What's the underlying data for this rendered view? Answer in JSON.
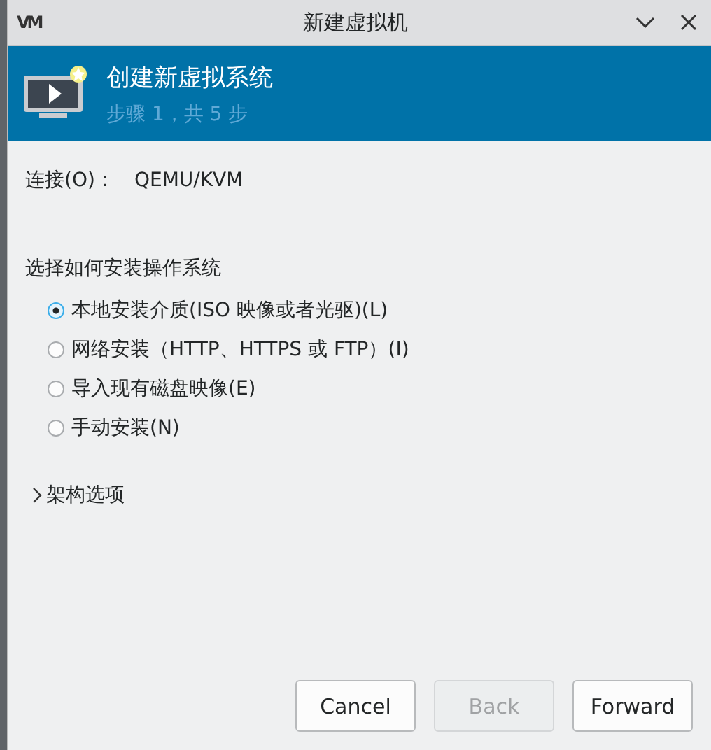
{
  "window": {
    "logo": "VM",
    "title": "新建虚拟机"
  },
  "header": {
    "title": "创建新虚拟系统",
    "step": "步骤 1，共 5 步"
  },
  "connection": {
    "label": "连接(O)：",
    "value": "QEMU/KVM"
  },
  "install": {
    "heading": "选择如何安装操作系统",
    "options": [
      {
        "label": "本地安装介质(ISO 映像或者光驱)(L)",
        "selected": true
      },
      {
        "label": "网络安装（HTTP、HTTPS 或 FTP）(I)",
        "selected": false
      },
      {
        "label": "导入现有磁盘映像(E)",
        "selected": false
      },
      {
        "label": "手动安装(N)",
        "selected": false
      }
    ]
  },
  "expander": {
    "label": "架构选项",
    "expanded": false
  },
  "buttons": [
    {
      "label": "Cancel",
      "disabled": false
    },
    {
      "label": "Back",
      "disabled": true
    },
    {
      "label": "Forward",
      "disabled": false
    }
  ]
}
